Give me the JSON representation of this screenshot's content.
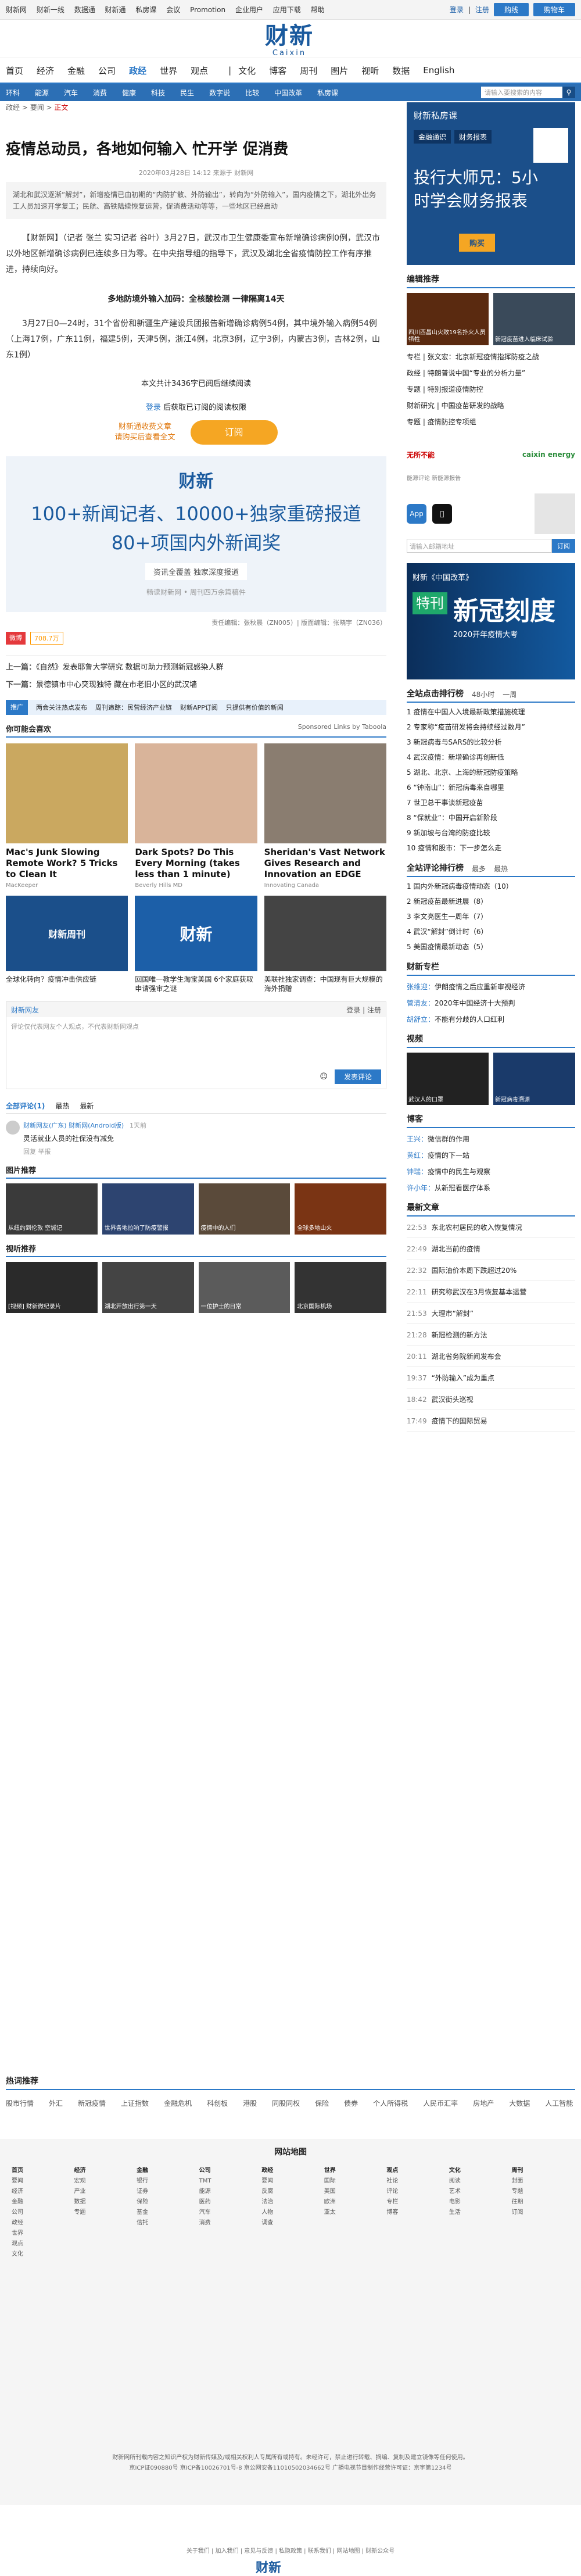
{
  "topbar": {
    "links": [
      "财新网",
      "财新一线",
      "数据通",
      "财新通",
      "私房课",
      "会议",
      "Promotion",
      "企业用户",
      "应用下载",
      "帮助"
    ],
    "login": "登录",
    "register": "注册",
    "btn1": "购线",
    "btn2": "购物车"
  },
  "logo": {
    "cn": "财新",
    "en": "Caixin"
  },
  "nav": [
    "首页",
    "经济",
    "金融",
    "公司",
    "政经",
    "世界",
    "观点",
    "文化",
    "博客",
    "周刊",
    "图片",
    "视听",
    "数据",
    "English"
  ],
  "nav_active": "政经",
  "subnav": [
    "环科",
    "能源",
    "汽车",
    "消费",
    "健康",
    "科技",
    "民生",
    "数字说",
    "比较",
    "中国改革",
    "私房课"
  ],
  "search_placeholder": "请输入要搜索的内容",
  "article": {
    "breadcrumb": [
      "政经",
      "要闻",
      "正文"
    ],
    "title": "疫情总动员，各地如何输入 忙开学 促消费",
    "meta": "2020年03月28日 14:12 来源于 财新网",
    "summary": "湖北和武汉逐渐“解封”，新增疫情已由初期的“内防扩散、外防输出”，转向为“外防输入”，国内疫情之下，湖北外出务工人员加速开学复工；民航、高铁陆续恢复运营，促消费活动等等，一些地区已经启动",
    "p1": "【财新网】（记者 张兰 实习记者 谷叶）3月27日，武汉市卫生健康委宣布新增确诊病例0例，武汉市以外地区新增确诊病例已连续多日为零。在中央指导组的指导下，武汉及湖北全省疫情防控工作有序推进，持续向好。",
    "sect": "多地防境外输入加码：全核酸检测 一律隔离14天",
    "p2": "3月27日0—24时，31个省份和新疆生产建设兵团报告新增确诊病例54例，其中境外输入病例54例（上海17例，广东11例，福建5例，天津5例，浙江4例，北京3例，辽宁3例，内蒙古3例，吉林2例，山东1例）",
    "count": "本文共计3436字已阅后继续阅读",
    "login": "登录",
    "login_tail": "后获取已订阅的阅读权限",
    "subtxt1": "财新通收费文章",
    "subtxt2": "请购买后查看全文",
    "subbtn": "订阅",
    "promo_logo": "财新",
    "promo_l1": "100+新闻记者、10000+独家重磅报道",
    "promo_l2": "80+项国内外新闻奖",
    "promo_tab": "资讯全覆盖 独家深度报道",
    "promo_cap": "畅读财新网 • 周刊四万余篇稿件",
    "editors": "责任编辑：张秋晨（ZN005）| 版面编辑：张晓宇（ZN036）",
    "share_label": "微博",
    "share_count": "708.7万",
    "prev_label": "上一篇：",
    "prev": "《自然》发表耶鲁大学研究 数据可助力预测新冠感染人群",
    "next_label": "下一篇：",
    "next": "景德镇市中心突现独特 藏在市老旧小区的武汉墙"
  },
  "tui": {
    "tag": "推广",
    "items": [
      "两会关注热点发布",
      "周刊追踪：民营经济产业链",
      "财新APP订阅",
      "只提供有价值的新闻"
    ]
  },
  "recommend": {
    "title": "你可能会喜欢",
    "sponsor": "Sponsored Links by Taboola",
    "cards": [
      {
        "t": "Mac's Junk Slowing Remote Work? 5 Tricks to Clean It",
        "s": "MacKeeper",
        "color": "#caa860"
      },
      {
        "t": "Dark Spots? Do This Every Morning (takes less than 1 minute)",
        "s": "Beverly Hills MD",
        "color": "#d9b49a"
      },
      {
        "t": "Sheridan's Vast Network Gives Research and Innovation an EDGE",
        "s": "Innovating Canada",
        "color": "#8a7d70"
      }
    ],
    "cards2": [
      {
        "t": "全球化转向？疫情冲击供应链",
        "color": "#1b4f8a",
        "label": "财新周刊"
      },
      {
        "t": "回国唯一教学生淘宝美国 6个家庭获取申请强审之谜",
        "color": "#1c5fa8",
        "label": "财新"
      },
      {
        "t": "美联社独家调查：中国现有巨大规模的海外捐赠",
        "color": "#444",
        "label": ""
      }
    ]
  },
  "comments": {
    "head": "财新网友",
    "login": "登录",
    "register": "注册",
    "placeholder": "评论仅代表网友个人观点，不代表财新网观点",
    "send": "发表评论",
    "tabs": [
      "全部评论(1)",
      "最热",
      "最新"
    ],
    "user": "财新网友(广东) 财新网(Android版)",
    "time": "1天前",
    "text": "灵活就业人员的社保没有减免",
    "action": "回复 举报"
  },
  "photos": {
    "title": "图片推荐",
    "items": [
      "从纽约到伦敦 空城记",
      "世界各地拉响了防疫警报",
      "疫情中的人们",
      "全球多地山火"
    ]
  },
  "videos_main": {
    "title": "视听推荐",
    "items": [
      "[视频] 财新微纪录片",
      "湖北开放出行第一天",
      "一位护士的日常",
      "北京国际机场"
    ]
  },
  "side": {
    "ad_title": "财新私房课",
    "ad_tabs": [
      "金融通识",
      "财务报表"
    ],
    "ad_big1": "投行大师兄：5小",
    "ad_big2": "时学会财务报表",
    "ad_btn": "购买",
    "pic_title": "编辑推荐",
    "thumbs": [
      "四川西昌山火致19名扑火人员牺牲",
      "新冠疫苗进入临床试验"
    ],
    "list": [
      "专栏 | 张文宏：北京新冠疫情指挥防疫之战",
      "政经 | 特朗普说中国“专业的分析力量”",
      "专题 | 特别报道疫情防控",
      "财新研究 | 中国疫苗研发的战略",
      "专题 | 疫情防控专项组"
    ],
    "logos_c": "无所不能",
    "logos_e": "caixin energy",
    "logo_note": "能源评论 新能源报告",
    "app1": "App",
    "app2": "",
    "email_placeholder": "请输入邮箱地址",
    "email_btn": "订阅",
    "banner_a": "财新《中国改革》",
    "banner_b": "特刊",
    "banner_c": "新冠刻度",
    "banner_d": "2020开年疫情大考",
    "rank_title": "全站点击排行榜",
    "rank_tabs": [
      "48小时",
      "一周"
    ],
    "rank": [
      "1 疫情在中国人入境最新政策措施梳理",
      "2 专家称“疫苗研发将会持续经过数月”",
      "3 新冠病毒与SARS的比较分析",
      "4 武汉疫情：新增确诊再创新低",
      "5 湖北、北京、上海的新冠防疫策略",
      "6 “钟南山”：新冠病毒来自哪里",
      "7 世卫总干事谈新冠疫苗",
      "8 “保就业”：中国开启新阶段",
      "9 新加坡与台湾的防疫比较",
      "10 疫情和股市：下一步怎么走"
    ],
    "rank2_title": "全站评论排行榜",
    "rank2_tabs": [
      "最多",
      "最热"
    ],
    "rank2": [
      "1 国内外新冠病毒疫情动态（10）",
      "2 新冠疫苗最新进展（8）",
      "3 李文亮医生一周年（7）",
      "4 武汉“解封”倒计时（6）",
      "5 美国疫情最新动态（5）"
    ],
    "auth_title": "财新专栏",
    "auth": [
      {
        "a": "张维迎：",
        "t": "伊朗疫情之后应重新审视经济"
      },
      {
        "a": "管清友：",
        "t": "2020年中国经济十大预判"
      },
      {
        "a": "胡舒立：",
        "t": "不能有分歧的人口红利"
      }
    ],
    "video_title": "视频",
    "videos": [
      "武汉人的口罩",
      "新冠病毒溯源"
    ],
    "blog_title": "博客",
    "blogs": [
      {
        "a": "王兴：",
        "t": "微信群的作用"
      },
      {
        "a": "黄红：",
        "t": "疫情的下一站"
      },
      {
        "a": "钟瑞：",
        "t": "疫情中的民生与观察"
      },
      {
        "a": "许小年：",
        "t": "从新冠看医疗体系"
      }
    ],
    "news_title": "最新文章",
    "news": [
      {
        "tm": "22:53",
        "t": "东北农村居民的收入恢复情况"
      },
      {
        "tm": "22:49",
        "t": "湖北当前的疫情"
      },
      {
        "tm": "22:32",
        "t": "国际油价本周下跌超过20%"
      },
      {
        "tm": "22:11",
        "t": "研究称武汉在3月恢复基本运营"
      },
      {
        "tm": "21:53",
        "t": "大理市“解封”"
      },
      {
        "tm": "21:28",
        "t": "新冠检测的新方法"
      },
      {
        "tm": "20:11",
        "t": "湖北省务院新闻发布会"
      },
      {
        "tm": "19:37",
        "t": "“外防输入”成为重点"
      },
      {
        "tm": "18:42",
        "t": "武汉街头巡视"
      },
      {
        "tm": "17:49",
        "t": "疫情下的国际贸易"
      }
    ]
  },
  "hot": {
    "title": "热词推荐",
    "items": [
      "股市行情",
      "外汇",
      "新冠疫情",
      "上证指数",
      "金融危机",
      "科创板",
      "港股",
      "同股同权",
      "保险",
      "债券",
      "个人所得税",
      "人民币汇率",
      "房地产",
      "大数据",
      "人工智能"
    ]
  },
  "sitemap": {
    "title": "网站地图",
    "cols": [
      {
        "h": "首页",
        "i": [
          "要闻",
          "经济",
          "金融",
          "公司",
          "政经",
          "世界",
          "观点",
          "文化"
        ]
      },
      {
        "h": "经济",
        "i": [
          "宏观",
          "产业",
          "数据",
          "专题"
        ]
      },
      {
        "h": "金融",
        "i": [
          "银行",
          "证券",
          "保险",
          "基金",
          "信托"
        ]
      },
      {
        "h": "公司",
        "i": [
          "TMT",
          "能源",
          "医药",
          "汽车",
          "消费"
        ]
      },
      {
        "h": "政经",
        "i": [
          "要闻",
          "反腐",
          "法治",
          "人物",
          "调查"
        ]
      },
      {
        "h": "世界",
        "i": [
          "国际",
          "美国",
          "欧洲",
          "亚太"
        ]
      },
      {
        "h": "观点",
        "i": [
          "社论",
          "评论",
          "专栏",
          "博客"
        ]
      },
      {
        "h": "文化",
        "i": [
          "阅读",
          "艺术",
          "电影",
          "生活"
        ]
      },
      {
        "h": "周刊",
        "i": [
          "封面",
          "专题",
          "往期",
          "订阅"
        ]
      }
    ]
  },
  "copyright": "财新网所刊载内容之知识产权为财新传媒及/或相关权利人专属所有或持有。未经许可，禁止进行转载、摘编、复制及建立镜像等任何使用。",
  "icp": "京ICP证090880号 京ICP备10026701号-8 京公网安备11010502034662号 广播电视节目制作经营许可证：京字第1234号",
  "bottom_links": "关于我们 | 加入我们 | 意见与反馈 | 私隐政策 | 联系我们 | 网站地图 | 财新公众号"
}
